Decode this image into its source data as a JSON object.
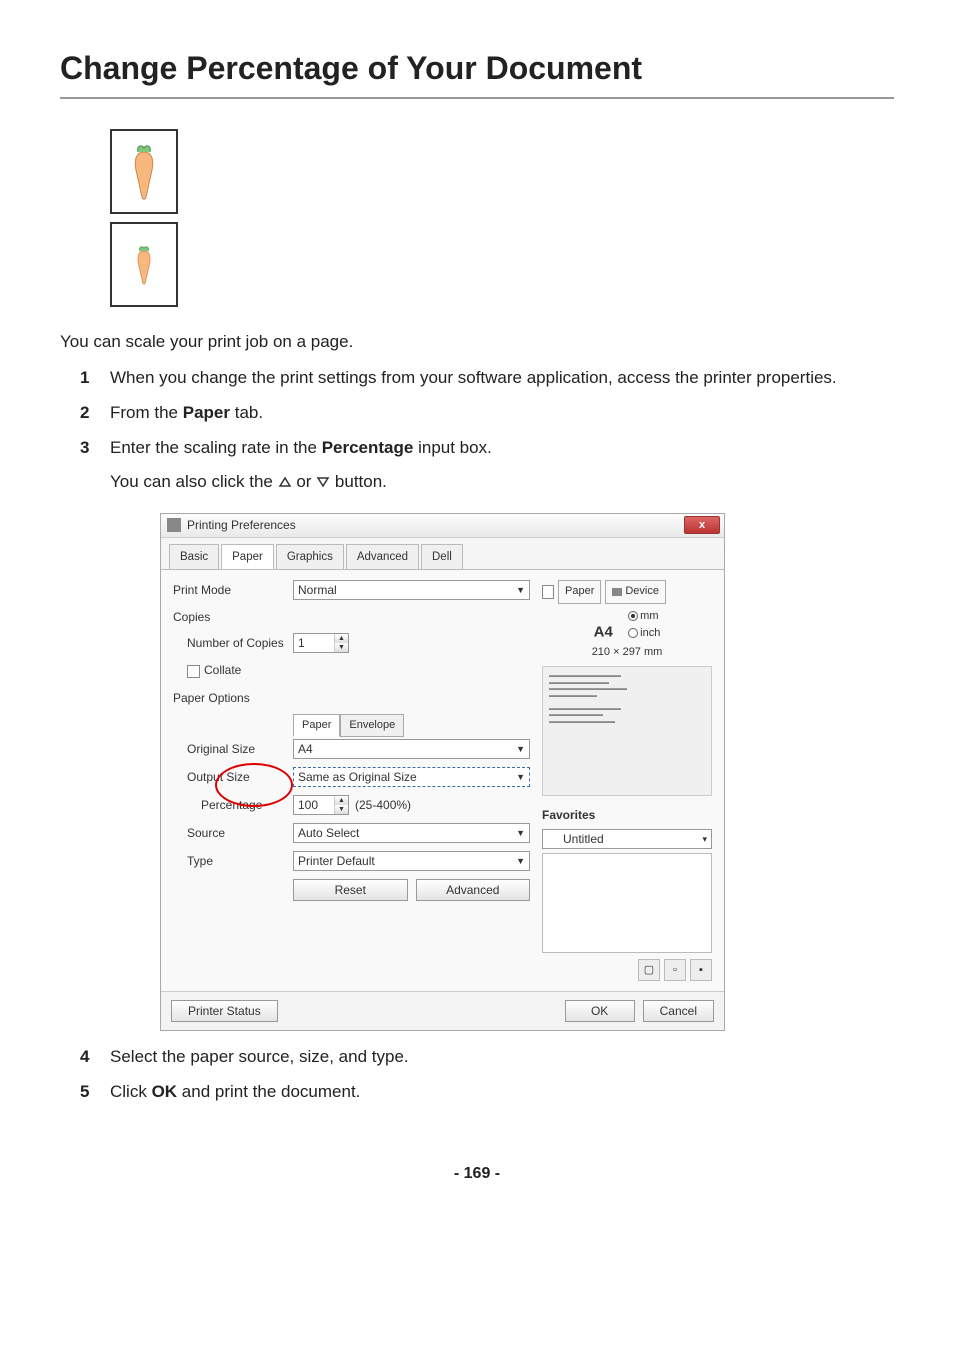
{
  "title": "Change Percentage of Your Document",
  "intro": "You can scale your print job on a page.",
  "steps": [
    {
      "text_before": "When you change the print settings from your software application, access the printer properties."
    },
    {
      "text_before": "From the ",
      "bold1": "Paper",
      "text_after": " tab."
    },
    {
      "text_before": "Enter the scaling rate in the ",
      "bold1": "Percentage",
      "text_after": " input box."
    },
    {
      "text_before": "Select the paper source, size, and type."
    },
    {
      "text_before": "Click ",
      "bold1": "OK",
      "text_after": " and print the document."
    }
  ],
  "subline_before": "You can also click the ",
  "subline_mid": " or ",
  "subline_after": " button.",
  "dialog": {
    "title": "Printing Preferences",
    "tabs": [
      "Basic",
      "Paper",
      "Graphics",
      "Advanced",
      "Dell"
    ],
    "active_tab": "Paper",
    "print_mode_label": "Print Mode",
    "print_mode_value": "Normal",
    "copies_heading": "Copies",
    "num_copies_label": "Number of Copies",
    "num_copies_value": "1",
    "collate_label": "Collate",
    "paper_options_heading": "Paper Options",
    "mini_tabs": [
      "Paper",
      "Envelope"
    ],
    "original_size_label": "Original Size",
    "original_size_value": "A4",
    "output_size_label": "Output Size",
    "output_size_value": "Same as Original Size",
    "percentage_label": "Percentage",
    "percentage_value": "100",
    "percentage_range": "(25-400%)",
    "source_label": "Source",
    "source_value": "Auto Select",
    "type_label": "Type",
    "type_value": "Printer Default",
    "reset_btn": "Reset",
    "advanced_btn": "Advanced",
    "right_tabs": [
      "Paper",
      "Device"
    ],
    "paper_size": "A4",
    "paper_dim": "210 × 297 mm",
    "unit_mm": "mm",
    "unit_inch": "inch",
    "favorites_label": "Favorites",
    "favorites_value": "Untitled",
    "printer_status_btn": "Printer Status",
    "ok_btn": "OK",
    "cancel_btn": "Cancel"
  },
  "page_number": "169"
}
